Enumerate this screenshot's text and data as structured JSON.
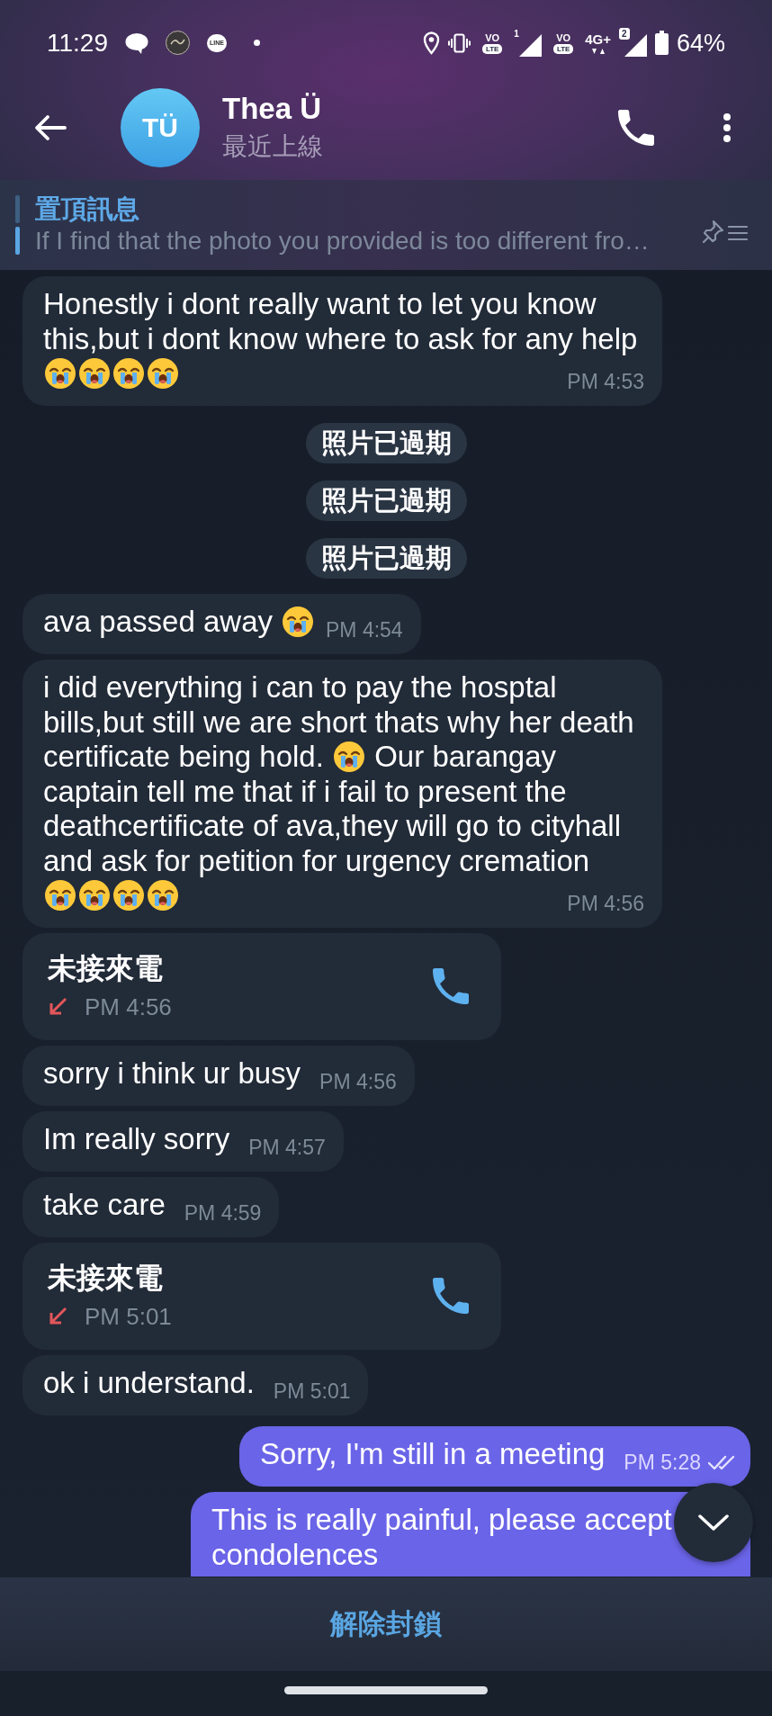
{
  "status_bar": {
    "time": "11:29",
    "notifications": [
      {
        "kind": "chat"
      },
      {
        "kind": "app"
      },
      {
        "kind": "logo",
        "label": "LINE"
      },
      {
        "kind": "more"
      }
    ],
    "sims": [
      {
        "volte_top": "VO",
        "volte_bottom": "LTE",
        "slot": "1",
        "data": false
      },
      {
        "volte_top": "VO",
        "volte_bottom": "LTE",
        "network": "4G+",
        "slot": "2",
        "data": true
      }
    ],
    "battery": "64%"
  },
  "header": {
    "initials": "TÜ",
    "name": "Thea Ü",
    "status": "最近上線"
  },
  "pinned": {
    "title": "置頂訊息",
    "text": "If I find that the photo you provided is too different fro…"
  },
  "messages": [
    {
      "kind": "text",
      "outgoing": false,
      "parts": [
        {
          "kind": "text",
          "text": "Honestly i dont really want to let you know this,but i dont know where to ask for any help"
        },
        {
          "kind": "emoji"
        },
        {
          "kind": "emoji"
        },
        {
          "kind": "emoji"
        },
        {
          "kind": "emoji"
        }
      ],
      "time": "PM 4:53"
    },
    {
      "kind": "service",
      "text": "照片已過期"
    },
    {
      "kind": "service",
      "text": "照片已過期"
    },
    {
      "kind": "service",
      "text": "照片已過期"
    },
    {
      "kind": "text",
      "outgoing": false,
      "parts": [
        {
          "kind": "text",
          "text": "ava passed away"
        },
        {
          "kind": "emoji"
        }
      ],
      "time": "PM 4:54"
    },
    {
      "kind": "text",
      "outgoing": false,
      "parts": [
        {
          "kind": "text",
          "text": "i did everything i can to pay the hosptal bills,but still we are short thats why her death certificate being hold. "
        },
        {
          "kind": "emoji"
        },
        {
          "kind": "text",
          "text": " Our barangay captain tell me that if i fail to present the deathcertificate of ava,they will go to cityhall and ask for petition for urgency cremation"
        },
        {
          "kind": "emoji"
        },
        {
          "kind": "emoji"
        },
        {
          "kind": "emoji"
        },
        {
          "kind": "emoji"
        }
      ],
      "time": "PM 4:56"
    },
    {
      "kind": "call",
      "title": "未接來電",
      "time": "PM 4:56"
    },
    {
      "kind": "text",
      "outgoing": false,
      "parts": [
        {
          "kind": "text",
          "text": "sorry i think ur busy"
        }
      ],
      "time": "PM 4:56"
    },
    {
      "kind": "text",
      "outgoing": false,
      "parts": [
        {
          "kind": "text",
          "text": "Im really sorry"
        }
      ],
      "time": "PM 4:57"
    },
    {
      "kind": "text",
      "outgoing": false,
      "parts": [
        {
          "kind": "text",
          "text": "take care"
        }
      ],
      "time": "PM 4:59"
    },
    {
      "kind": "call",
      "title": "未接來電",
      "time": "PM 5:01"
    },
    {
      "kind": "text",
      "outgoing": false,
      "parts": [
        {
          "kind": "text",
          "text": "ok i understand."
        }
      ],
      "time": "PM 5:01"
    },
    {
      "kind": "text",
      "outgoing": true,
      "parts": [
        {
          "kind": "text",
          "text": "Sorry, I'm still in a meeting"
        }
      ],
      "time": "PM 5:28",
      "read": true
    },
    {
      "kind": "text",
      "outgoing": true,
      "parts": [
        {
          "kind": "text",
          "text": "This is really painful, please accept condolences"
        }
      ]
    }
  ],
  "bottom_bar": {
    "button": "解除封鎖"
  }
}
